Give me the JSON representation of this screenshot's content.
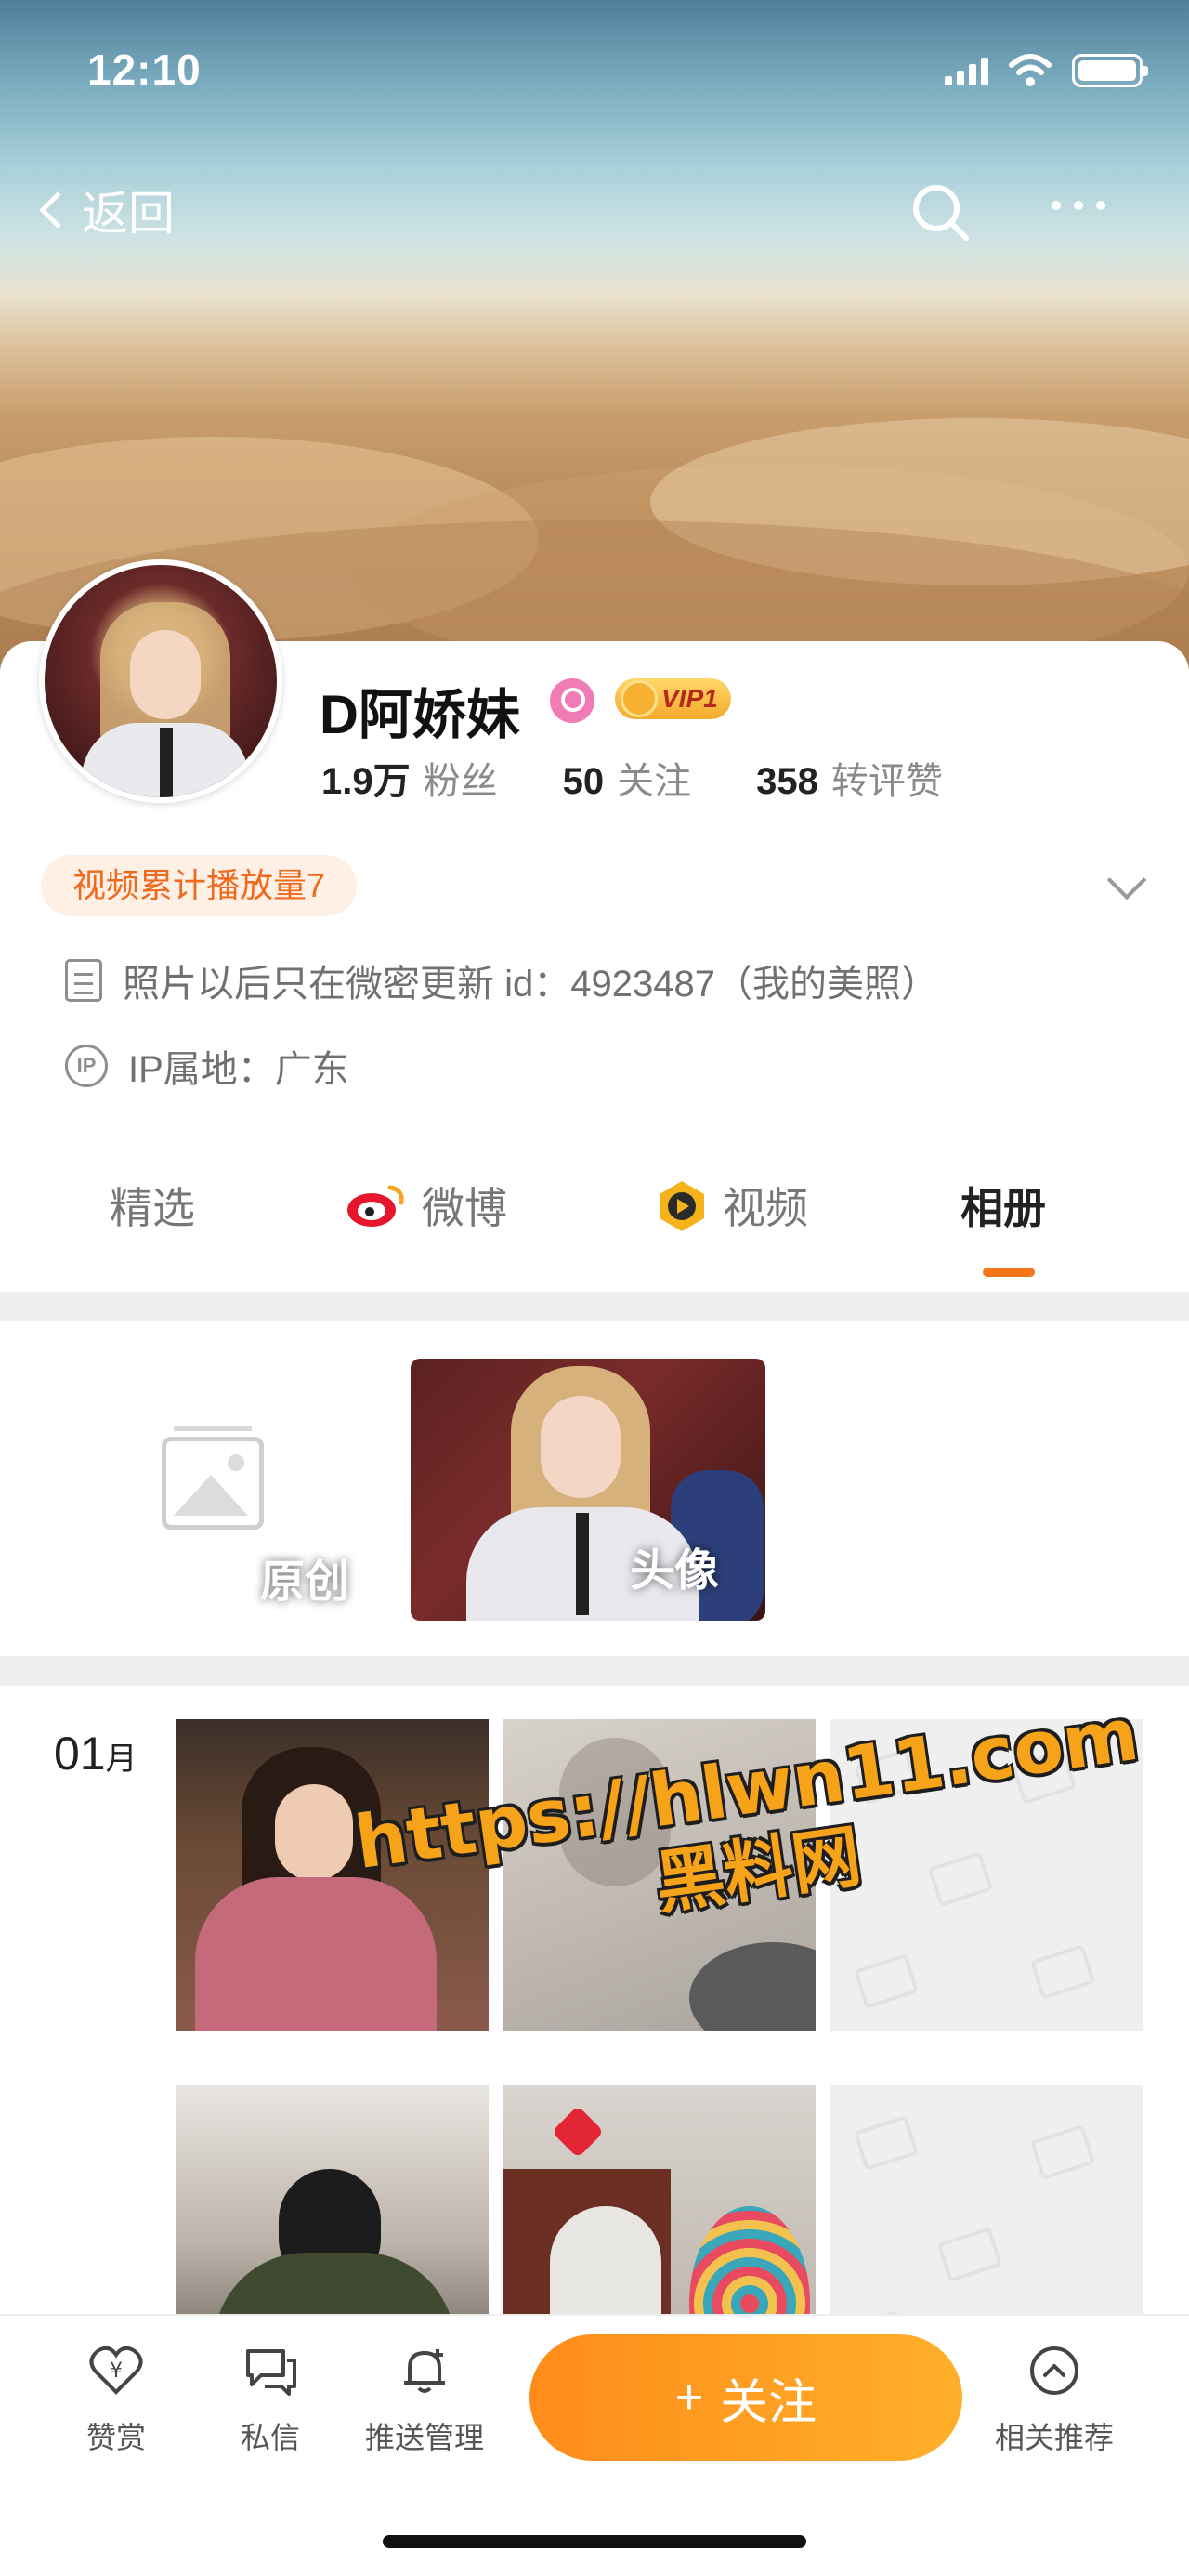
{
  "status": {
    "time": "12:10"
  },
  "nav": {
    "back_label": "返回"
  },
  "profile": {
    "username": "D阿娇妹",
    "vip_label": "VIP1",
    "stats": [
      {
        "value": "1.9万",
        "label": "粉丝"
      },
      {
        "value": "50",
        "label": "关注"
      },
      {
        "value": "358",
        "label": "转评赞"
      }
    ],
    "play_badge": "视频累计播放量7",
    "bio": "照片以后只在微密更新 id：4923487（我的美照）",
    "ip": "IP属地：广东",
    "ip_icon_text": "IP"
  },
  "tabs": [
    {
      "label": "精选",
      "active": false
    },
    {
      "label": "微博",
      "active": false
    },
    {
      "label": "视频",
      "active": false
    },
    {
      "label": "相册",
      "active": true
    }
  ],
  "albums": [
    {
      "label": "原创"
    },
    {
      "label": "头像"
    }
  ],
  "photos": {
    "month": "01",
    "month_suffix": "月"
  },
  "watermark": {
    "line1": "https://hlwn11.com",
    "line2": "黑料网"
  },
  "bottom_bar": {
    "items": [
      {
        "label": "赞赏",
        "icon": "heart-yen-icon"
      },
      {
        "label": "私信",
        "icon": "chat-icon"
      },
      {
        "label": "推送管理",
        "icon": "bell-icon"
      },
      {
        "label": "相关推荐",
        "icon": "chevron-up-circle-icon"
      }
    ],
    "follow_label": "关注",
    "follow_icon": "+"
  },
  "colors": {
    "accent": "#f5751b",
    "follow_gradient_start": "#ff8c1a",
    "follow_gradient_end": "#ffb02a",
    "watermark": "#f7a31a"
  }
}
